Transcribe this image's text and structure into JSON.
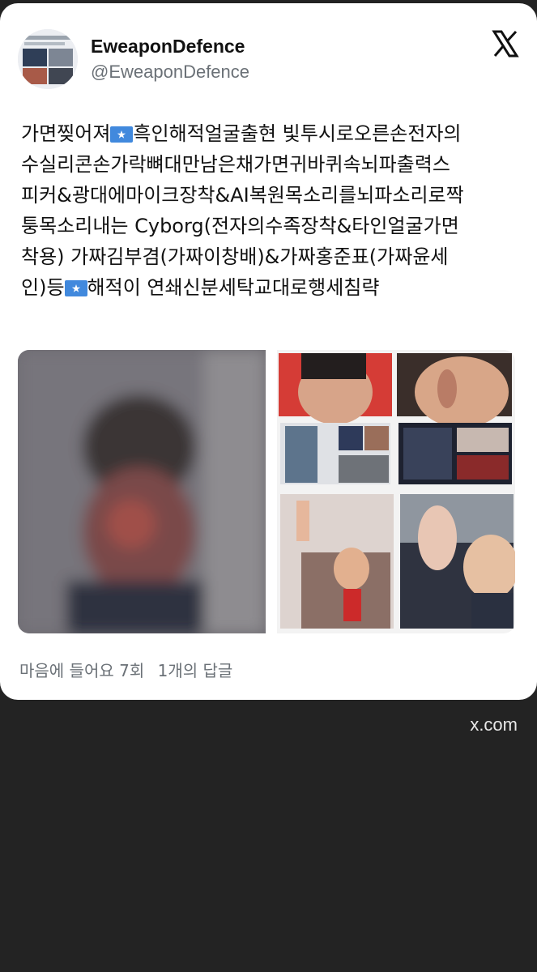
{
  "post": {
    "display_name": "EweaponDefence",
    "handle": "@EweaponDefence",
    "text_line1": "가면찢어져",
    "text_line1b": "흑인해적얼굴출현 빛투시로오른손전자의",
    "text_line2": "수실리콘손가락뼈대만남은채가면귀바퀴속뇌파출력스",
    "text_line3": "피커&광대에마이크장착&AI복원목소리를뇌파소리로짝",
    "text_line4": "퉁목소리내는 Cyborg(전자의수족장착&타인얼굴가면",
    "text_line5": "착용) 가짜김부겸(가짜이창배)&가짜홍준표(가짜윤세",
    "text_line6a": "인)등",
    "text_line6b": "해적이 연쇄신분세탁교대로행세침략",
    "likes": "마음에 들어요 7회",
    "replies": "1개의 답글"
  },
  "source_domain": "x.com",
  "icons": {
    "platform": "x-logo-icon",
    "flag": "somalia-flag-icon"
  },
  "colors": {
    "page_bg": "#232323",
    "card_bg": "#ffffff",
    "muted": "#6b7177",
    "flag_blue": "#4189dd"
  }
}
